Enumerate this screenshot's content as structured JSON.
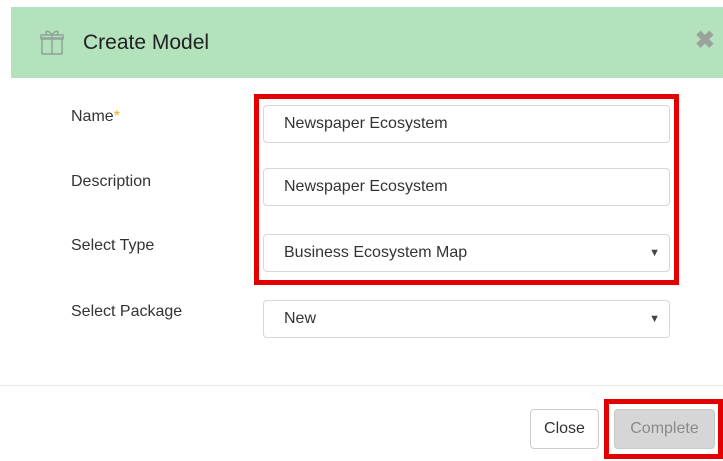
{
  "dialog": {
    "title": "Create Model",
    "header_color": "#b3e2bd"
  },
  "form": {
    "name": {
      "label": "Name",
      "required_mark": "*",
      "value": "Newspaper Ecosystem"
    },
    "description": {
      "label": "Description",
      "value": "Newspaper Ecosystem"
    },
    "type": {
      "label": "Select Type",
      "selected": "Business Ecosystem Map"
    },
    "package": {
      "label": "Select Package",
      "selected": "New"
    }
  },
  "footer": {
    "close_label": "Close",
    "complete_label": "Complete"
  },
  "icons": {
    "header": "gift-icon",
    "close": "close-x-icon",
    "dropdown": "caret-down-icon"
  },
  "colors": {
    "highlight": "#e20000",
    "required": "#f0ad1e"
  }
}
